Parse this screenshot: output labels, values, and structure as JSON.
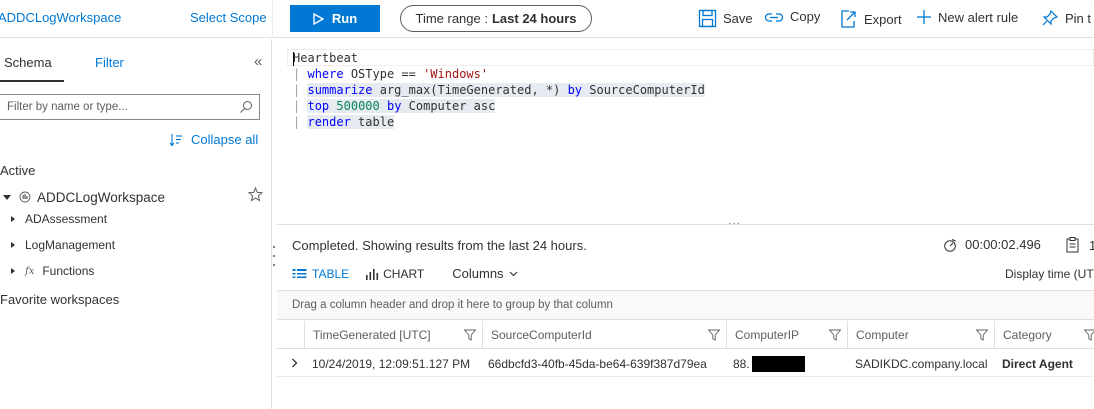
{
  "toolbar": {
    "workspace": "ADDCLogWorkspace",
    "select_scope": "Select Scope",
    "run": "Run",
    "time_range_label": "Time range :",
    "time_range_value": "Last 24 hours",
    "save": "Save",
    "copy": "Copy",
    "export": "Export",
    "new_alert_rule": "New alert rule",
    "pin": "Pin t"
  },
  "left_pane": {
    "tab_schema": "Schema",
    "tab_filter": "Filter",
    "collapse_glyph": "«",
    "filter_placeholder": "Filter by name or type...",
    "collapse_all": "Collapse all",
    "active_label": "Active",
    "workspace_name": "ADDCLogWorkspace",
    "tree": [
      {
        "label": "ADAssessment"
      },
      {
        "label": "LogManagement"
      },
      {
        "label": "Functions",
        "icon_text": "fx"
      }
    ],
    "favorites_label": "Favorite workspaces"
  },
  "editor": {
    "line1": "eartbeat",
    "line1_first_char": "H",
    "pipe": "|",
    "l2_kw": "where",
    "l2_mid": " OSType == ",
    "l2_str": "'Windows'",
    "l3_kw": "summarize",
    "l3_mid": " arg_max(TimeGenerated, *) ",
    "l3_kw2": "by",
    "l3_end": " SourceComputerId",
    "l4_kw": "top",
    "l4_num": "500000",
    "l4_kw2": "by",
    "l4_end": " Computer asc",
    "l5_kw": "render",
    "l5_end": " table"
  },
  "results": {
    "status": "Completed. Showing results from the last 24 hours.",
    "elapsed": "00:00:02.496",
    "copy_count": "1",
    "tab_table": "TABLE",
    "tab_chart": "CHART",
    "columns": "Columns",
    "display_time": "Display time (UT",
    "group_hint": "Drag a column header and drop it here to group by that column",
    "headers": [
      "TimeGenerated [UTC]",
      "SourceComputerId",
      "ComputerIP",
      "Computer",
      "Category"
    ],
    "row": {
      "time": "10/24/2019, 12:09:51.127 PM",
      "source_id": "66dbcfd3-40fb-45da-be64-639f387d79ea",
      "ip_prefix": "88.",
      "computer": "SADIKDC.company.local",
      "category": "Direct Agent"
    }
  },
  "colors": {
    "accent": "#0078d4",
    "keyword": "#0000ff",
    "string": "#a31515",
    "number": "#098658"
  }
}
